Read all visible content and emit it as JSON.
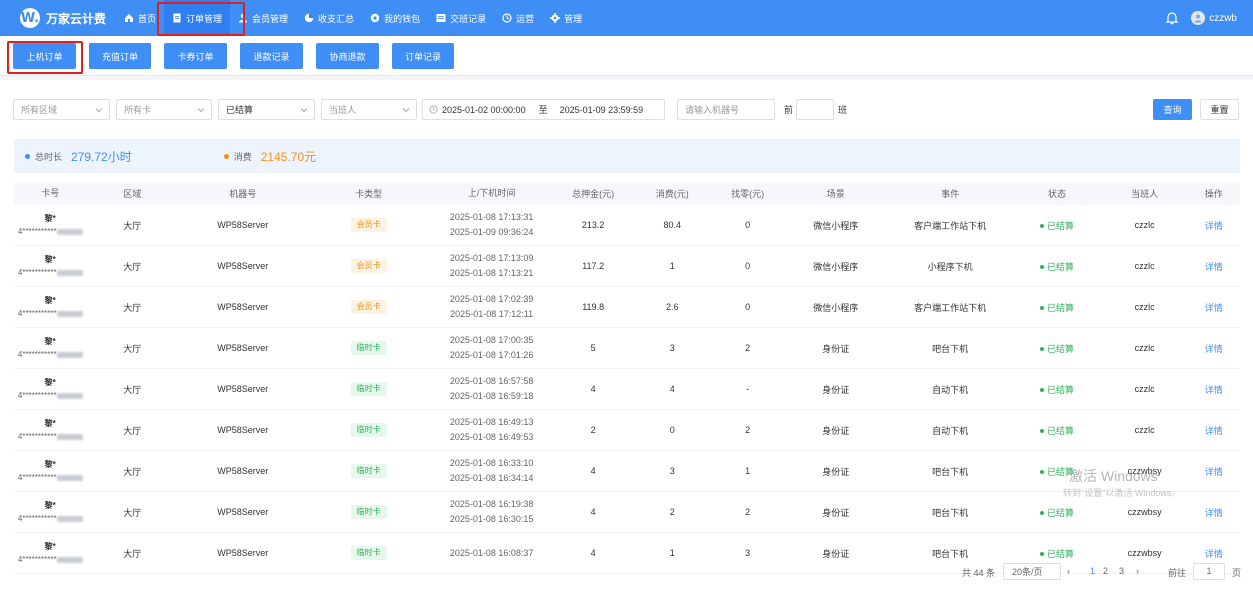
{
  "app": {
    "logo_letter": "W.",
    "name": "万家云计费"
  },
  "nav": {
    "items": [
      {
        "label": "首页",
        "icon": "home-icon"
      },
      {
        "label": "订单管理",
        "icon": "document-icon",
        "active": true
      },
      {
        "label": "会员管理",
        "icon": "user-icon"
      },
      {
        "label": "收支汇总",
        "icon": "pie-chart-icon"
      },
      {
        "label": "我的钱包",
        "icon": "wallet-icon"
      },
      {
        "label": "交班记录",
        "icon": "list-icon"
      },
      {
        "label": "运营",
        "icon": "clock-icon"
      },
      {
        "label": "管理",
        "icon": "gear-icon"
      }
    ],
    "username": "czzwb"
  },
  "subtabs": [
    {
      "label": "上机订单",
      "active": true
    },
    {
      "label": "充值订单"
    },
    {
      "label": "卡券订单"
    },
    {
      "label": "退款记录"
    },
    {
      "label": "协商退款"
    },
    {
      "label": "订单记录"
    }
  ],
  "filters": {
    "area_placeholder": "所有区域",
    "card_placeholder": "所有卡",
    "status_value": "已结算",
    "shift_placeholder": "当班人",
    "date_start": "2025-01-02 00:00:00",
    "date_sep": "至",
    "date_end": "2025-01-09 23:59:59",
    "machine_placeholder": "请输入机器号",
    "prev_label": "前",
    "shift_suffix": "班",
    "search_label": "查询",
    "reset_label": "重置"
  },
  "summary": {
    "duration_label": "总时长",
    "duration_value": "279.72小时",
    "consume_label": "消费",
    "consume_value": "2145.70元"
  },
  "table": {
    "headers": [
      "卡号",
      "区域",
      "机器号",
      "卡类型",
      "上/下机时间",
      "总押金(元)",
      "消费(元)",
      "找零(元)",
      "场景",
      "事件",
      "状态",
      "当班人",
      "操作"
    ],
    "rows": [
      {
        "name": "黎*",
        "card": "4***********",
        "area": "大厅",
        "machine": "WP58Server",
        "type": "会员卡",
        "type_kind": "member",
        "start": "2025-01-08 17:13:31",
        "end": "2025-01-09 09:36:24",
        "deposit": "213.2",
        "consume": "80.4",
        "change": "0",
        "scene": "微信小程序",
        "event": "客户端工作站下机",
        "status": "已结算",
        "operator": "czzlc",
        "action": "详情"
      },
      {
        "name": "黎*",
        "card": "4***********",
        "area": "大厅",
        "machine": "WP58Server",
        "type": "会员卡",
        "type_kind": "member",
        "start": "2025-01-08 17:13:09",
        "end": "2025-01-08 17:13:21",
        "deposit": "117.2",
        "consume": "1",
        "change": "0",
        "scene": "微信小程序",
        "event": "小程序下机",
        "status": "已结算",
        "operator": "czzlc",
        "action": "详情"
      },
      {
        "name": "黎*",
        "card": "4***********",
        "area": "大厅",
        "machine": "WP58Server",
        "type": "会员卡",
        "type_kind": "member",
        "start": "2025-01-08 17:02:39",
        "end": "2025-01-08 17:12:11",
        "deposit": "119.8",
        "consume": "2.6",
        "change": "0",
        "scene": "微信小程序",
        "event": "客户端工作站下机",
        "status": "已结算",
        "operator": "czzlc",
        "action": "详情"
      },
      {
        "name": "黎*",
        "card": "4***********",
        "area": "大厅",
        "machine": "WP58Server",
        "type": "临时卡",
        "type_kind": "temp",
        "start": "2025-01-08 17:00:35",
        "end": "2025-01-08 17:01:26",
        "deposit": "5",
        "consume": "3",
        "change": "2",
        "scene": "身份证",
        "event": "吧台下机",
        "status": "已结算",
        "operator": "czzlc",
        "action": "详情"
      },
      {
        "name": "黎*",
        "card": "4***********",
        "area": "大厅",
        "machine": "WP58Server",
        "type": "临时卡",
        "type_kind": "temp",
        "start": "2025-01-08 16:57:58",
        "end": "2025-01-08 16:59:18",
        "deposit": "4",
        "consume": "4",
        "change": "-",
        "scene": "身份证",
        "event": "自动下机",
        "status": "已结算",
        "operator": "czzlc",
        "action": "详情"
      },
      {
        "name": "黎*",
        "card": "4***********",
        "area": "大厅",
        "machine": "WP58Server",
        "type": "临时卡",
        "type_kind": "temp",
        "start": "2025-01-08 16:49:13",
        "end": "2025-01-08 16:49:53",
        "deposit": "2",
        "consume": "0",
        "change": "2",
        "scene": "身份证",
        "event": "自动下机",
        "status": "已结算",
        "operator": "czzlc",
        "action": "详情"
      },
      {
        "name": "黎*",
        "card": "4***********",
        "area": "大厅",
        "machine": "WP58Server",
        "type": "临时卡",
        "type_kind": "temp",
        "start": "2025-01-08 16:33:10",
        "end": "2025-01-08 16:34:14",
        "deposit": "4",
        "consume": "3",
        "change": "1",
        "scene": "身份证",
        "event": "吧台下机",
        "status": "已结算",
        "operator": "czzwbsy",
        "action": "详情"
      },
      {
        "name": "黎*",
        "card": "4***********",
        "area": "大厅",
        "machine": "WP58Server",
        "type": "临时卡",
        "type_kind": "temp",
        "start": "2025-01-08 16:19:38",
        "end": "2025-01-08 16:30:15",
        "deposit": "4",
        "consume": "2",
        "change": "2",
        "scene": "身份证",
        "event": "吧台下机",
        "status": "已结算",
        "operator": "czzwbsy",
        "action": "详情"
      },
      {
        "name": "黎*",
        "card": "4***********",
        "area": "大厅",
        "machine": "WP58Server",
        "type": "临时卡",
        "type_kind": "temp",
        "start": "2025-01-08 16:08:37",
        "end": "",
        "deposit": "4",
        "consume": "1",
        "change": "3",
        "scene": "身份证",
        "event": "吧台下机",
        "status": "已结算",
        "operator": "czzwbsy",
        "action": "详情"
      }
    ]
  },
  "pagination": {
    "total": "共 44 条",
    "page_size": "20条/页",
    "pages": [
      "2",
      "3"
    ],
    "goto_label": "前往",
    "goto_value": "1",
    "page_suffix": "页"
  },
  "watermark": {
    "line1": "激活 Windows",
    "line2": "转到\"设置\"以激活 Windows。"
  },
  "colors": {
    "primary": "#3f8ef5",
    "success": "#2eb35a",
    "warning": "#f0901a",
    "highlight": "#e02020"
  }
}
